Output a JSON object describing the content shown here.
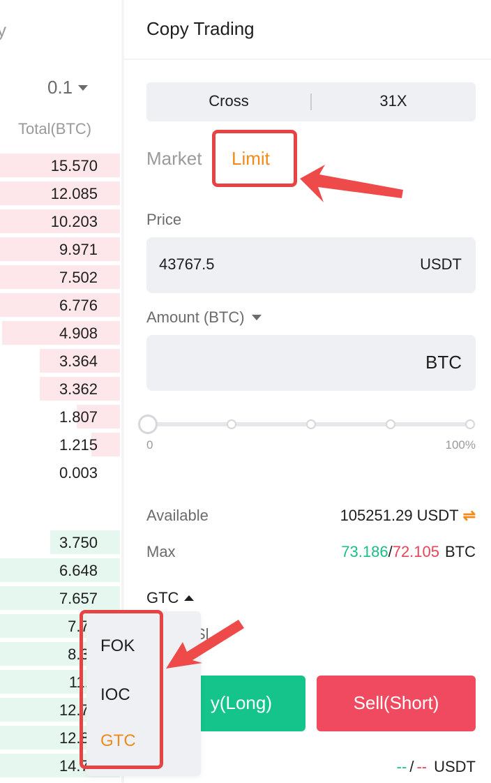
{
  "orderbook": {
    "title_partial": "y",
    "precision": "0.1",
    "total_header": "Total(BTC)",
    "asks": [
      {
        "total": "15.570",
        "depth": 1.0
      },
      {
        "total": "12.085",
        "depth": 1.0
      },
      {
        "total": "10.203",
        "depth": 1.0
      },
      {
        "total": "9.971",
        "depth": 1.0
      },
      {
        "total": "7.502",
        "depth": 1.0
      },
      {
        "total": "6.776",
        "depth": 1.0
      },
      {
        "total": "4.908",
        "depth": 0.98
      },
      {
        "total": "3.364",
        "depth": 0.67
      },
      {
        "total": "3.362",
        "depth": 0.67
      },
      {
        "total": "1.807",
        "depth": 0.36
      },
      {
        "total": "1.215",
        "depth": 0.24
      },
      {
        "total": "0.003",
        "depth": 0.0
      }
    ],
    "bids": [
      {
        "total": "3.750",
        "depth": 0.58
      },
      {
        "total": "6.648",
        "depth": 1.0
      },
      {
        "total": "7.657",
        "depth": 1.0
      },
      {
        "total": "7.73",
        "depth": 1.0
      },
      {
        "total": "8.39",
        "depth": 1.0
      },
      {
        "total": "11.1",
        "depth": 1.0
      },
      {
        "total": "12.72",
        "depth": 1.0
      },
      {
        "total": "12.87",
        "depth": 1.0
      },
      {
        "total": "14.75",
        "depth": 1.0
      }
    ]
  },
  "panel": {
    "title": "Copy Trading",
    "margin_mode": "Cross",
    "leverage": "31X",
    "tab_market": "Market",
    "tab_limit": "Limit",
    "price_label": "Price",
    "price_value": "43767.5",
    "price_unit": "USDT",
    "amount_label": "Amount (BTC)",
    "amount_unit": "BTC",
    "slider_min": "0",
    "slider_max": "100%",
    "available_label": "Available",
    "available_value": "105251.29 USDT",
    "max_label": "Max",
    "max_buy": "73.186",
    "max_sep": "/",
    "max_sell": "72.105",
    "max_unit": "BTC",
    "tif_selected": "GTC",
    "tpsl_partial": "Sl",
    "buy_label_partial": "y(Long)",
    "sell_label": "Sell(Short)",
    "cost_buy": "--",
    "cost_sep": "/",
    "cost_sell": "--",
    "cost_unit": "USDT"
  },
  "tif_menu": {
    "options": [
      "FOK",
      "IOC",
      "GTC"
    ],
    "selected": "GTC"
  },
  "colors": {
    "accent": "#f08a1a",
    "buy": "#14c48a",
    "sell": "#ef4a60",
    "annotation": "#e84343"
  }
}
